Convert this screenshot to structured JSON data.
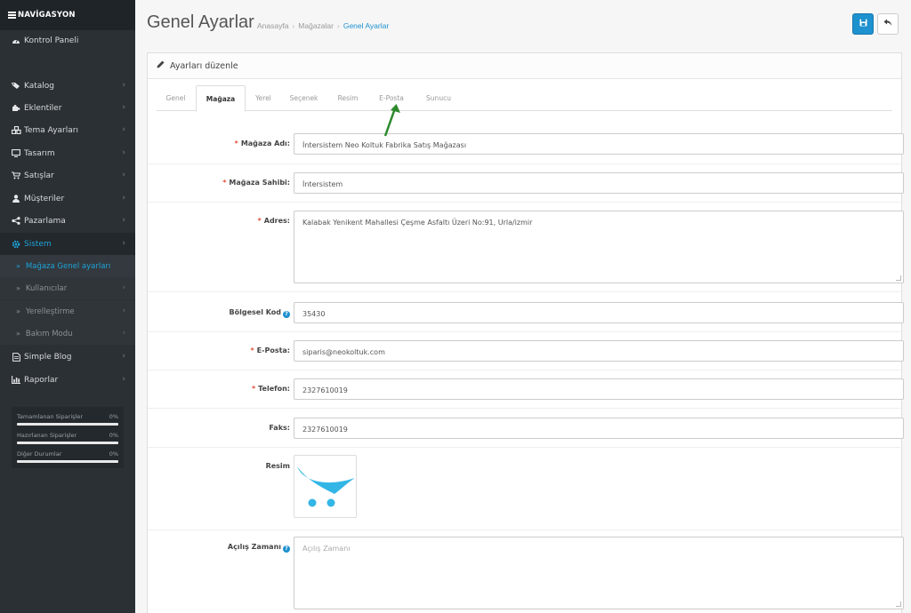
{
  "sidebar": {
    "nav_title": "NAVİGASYON",
    "dashboard": "Kontrol Paneli",
    "items": [
      {
        "label": "Katalog",
        "icon": "tags-icon"
      },
      {
        "label": "Eklentiler",
        "icon": "puzzle-icon"
      },
      {
        "label": "Tema Ayarları",
        "icon": "cubes-icon"
      },
      {
        "label": "Tasarım",
        "icon": "monitor-icon"
      },
      {
        "label": "Satışlar",
        "icon": "cart-icon"
      },
      {
        "label": "Müşteriler",
        "icon": "user-icon"
      },
      {
        "label": "Pazarlama",
        "icon": "share-icon"
      },
      {
        "label": "Sistem",
        "icon": "gear-icon"
      }
    ],
    "sub_items": [
      {
        "label": "Mağaza Genel ayarları"
      },
      {
        "label": "Kullanıcılar"
      },
      {
        "label": "Yerelleştirme"
      },
      {
        "label": "Bakım Modu"
      }
    ],
    "bottom_items": [
      {
        "label": "Simple Blog",
        "icon": "document-icon"
      },
      {
        "label": "Raporlar",
        "icon": "bar-chart-icon"
      }
    ],
    "stats": [
      {
        "label": "Tamamlanan Siparişler",
        "value": "0%",
        "progress": 0
      },
      {
        "label": "Hazırlanan Siparişler",
        "value": "0%",
        "progress": 0
      },
      {
        "label": "Diğer Durumlar",
        "value": "0%",
        "progress": 0
      }
    ]
  },
  "header": {
    "title": "Genel Ayarlar",
    "breadcrumb": [
      "Anasayfa",
      "Mağazalar",
      "Genel Ayarlar"
    ]
  },
  "panel": {
    "heading": "Ayarları düzenle",
    "tabs": [
      "Genel",
      "Mağaza",
      "Yerel",
      "Seçenek",
      "Resim",
      "E-Posta",
      "Sunucu"
    ],
    "active_tab": "Mağaza"
  },
  "form": {
    "store_name": {
      "label": "Mağaza Adı:",
      "value": "İntersistem Neo Koltuk Fabrika Satış Mağazası"
    },
    "owner": {
      "label": "Mağaza Sahibi:",
      "value": "İntersistem"
    },
    "address": {
      "label": "Adres:",
      "value": "Kalabak Yenikent Mahallesi Çeşme Asfaltı Üzeri No:91, Urla/izmir"
    },
    "region_code": {
      "label": "Bölgesel Kod",
      "value": "35430"
    },
    "email": {
      "label": "E-Posta:",
      "value": "siparis@neokoltuk.com"
    },
    "phone": {
      "label": "Telefon:",
      "value": "2327610019"
    },
    "fax": {
      "label": "Faks:",
      "value": "2327610019"
    },
    "image": {
      "label": "Resim"
    },
    "opening_hours": {
      "label": "Açılış Zamanı",
      "placeholder": "Açılış Zamanı"
    }
  },
  "colors": {
    "accent": "#1e91cf",
    "sidebar_bg": "#2b3034",
    "required": "#e3503e",
    "arrow": "#2c8a2c"
  }
}
